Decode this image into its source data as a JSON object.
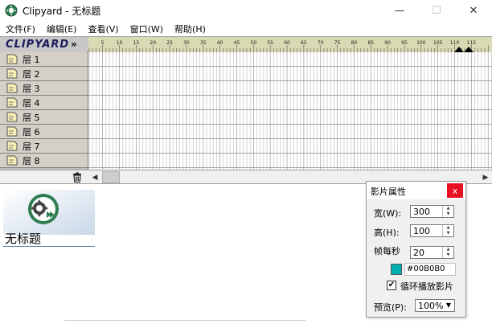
{
  "window": {
    "title": "Clipyard - 无标题",
    "minimize": "—",
    "maximize": "☐",
    "close": "✕"
  },
  "menu": [
    {
      "label": "文件(F)"
    },
    {
      "label": "编辑(E)"
    },
    {
      "label": "查看(V)"
    },
    {
      "label": "窗口(W)"
    },
    {
      "label": "帮助(H)"
    }
  ],
  "logo": {
    "text": "CLIPYARD",
    "arrows": "»"
  },
  "ruler": {
    "labels": [
      "5",
      "10",
      "15",
      "20",
      "25",
      "30",
      "35",
      "40",
      "45",
      "50",
      "55",
      "60",
      "65",
      "70",
      "75",
      "80",
      "85",
      "90",
      "95",
      "100",
      "105",
      "110",
      "115"
    ]
  },
  "layers": [
    {
      "label": "层 1"
    },
    {
      "label": "层 2"
    },
    {
      "label": "层 3"
    },
    {
      "label": "层 4"
    },
    {
      "label": "层 5"
    },
    {
      "label": "层 6"
    },
    {
      "label": "层 7"
    },
    {
      "label": "层 8"
    }
  ],
  "scroll": {
    "left_arrow": "◀",
    "right_arrow": "▶"
  },
  "scene": {
    "title": "无标题"
  },
  "properties": {
    "title": "影片属性",
    "close": "x",
    "width_label": "宽(W):",
    "width_value": "300",
    "height_label": "高(H):",
    "height_value": "100",
    "fps_label": "帧每秒",
    "fps_value": "20",
    "color_value": "#00B0B0",
    "loop_label": "循环播放影片",
    "loop_checked": "✔",
    "preview_label": "预览(P):",
    "preview_value": "100%",
    "color_hex": "#00b0b0"
  },
  "colors": {
    "accent": "#00b0b0",
    "ruler": "#d9d9b3",
    "close_red": "#e81123"
  }
}
